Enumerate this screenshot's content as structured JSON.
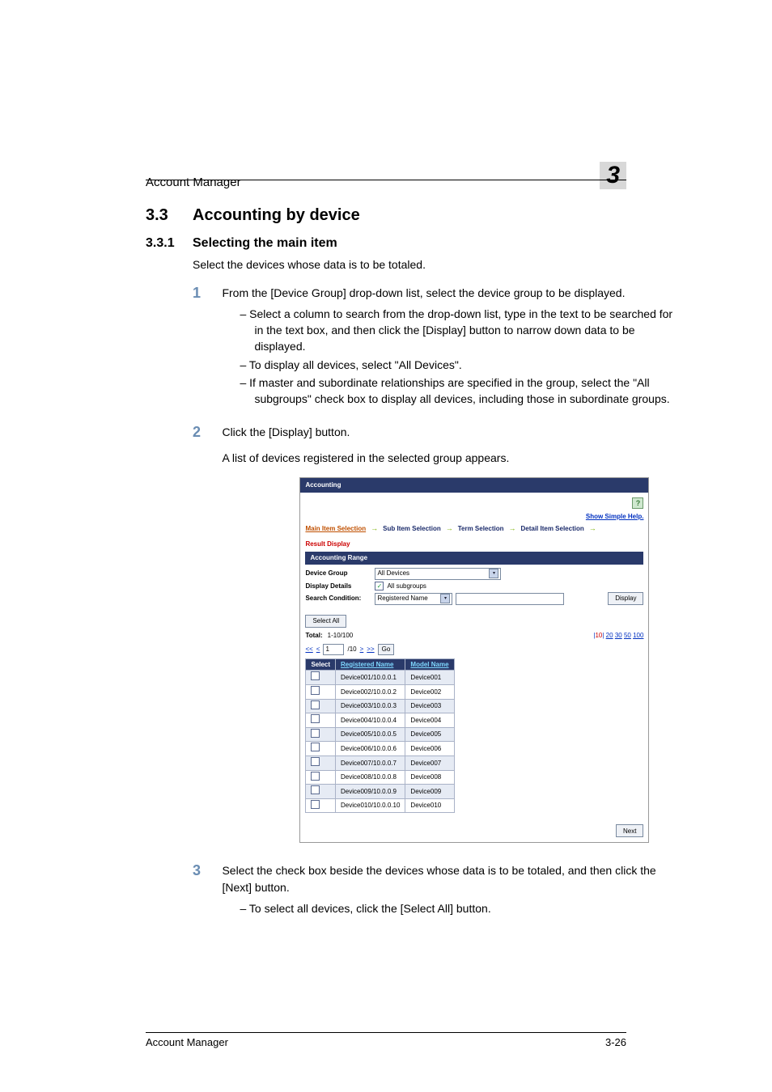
{
  "header": {
    "running": "Account Manager",
    "chapter": "3"
  },
  "section": {
    "h2_num": "3.3",
    "h2_title": "Accounting by device",
    "h3_num": "3.3.1",
    "h3_title": "Selecting the main item",
    "intro": "Select the devices whose data is to be totaled.",
    "steps": {
      "s1": {
        "num": "1",
        "text": "From the [Device Group] drop-down list, select the device group to be displayed.",
        "bullets": [
          "Select a column to search from the drop-down list, type in the text to be searched for in the text box, and then click the [Display] button to narrow down data to be displayed.",
          "To display all devices, select \"All Devices\".",
          "If master and subordinate relationships are specified in the group, select the \"All subgroups\" check box to display all devices, including those in subordinate groups."
        ]
      },
      "s2": {
        "num": "2",
        "text": "Click the [Display] button.",
        "after": "A list of devices registered in the selected group appears."
      },
      "s3": {
        "num": "3",
        "text": "Select the check box beside the devices whose data is to be totaled, and then click the [Next] button.",
        "bullets": [
          "To select all devices, click the [Select All] button."
        ]
      }
    }
  },
  "shot": {
    "title": "Accounting",
    "help_icon": "?",
    "simple_help": "Show Simple Help.",
    "crumbs": {
      "c1": "Main Item Selection",
      "c2": "Sub Item Selection",
      "c3": "Term Selection",
      "c4": "Detail Item Selection",
      "c5": "Result Display"
    },
    "range_hdr": "Accounting Range",
    "device_group_lbl": "Device Group",
    "device_group_val": "All Devices",
    "display_details_lbl": "Display Details",
    "all_subgroups_lbl": "All subgroups",
    "all_subgroups_checked": "✓",
    "search_condition_lbl": "Search Condition:",
    "search_col_val": "Registered Name",
    "display_btn": "Display",
    "select_all_btn": "Select All",
    "total_lbl": "Total:",
    "total_val": "1-10/100",
    "page_sizes": {
      "cur": "10",
      "opts": [
        "20",
        "30",
        "50",
        "100"
      ]
    },
    "pager": {
      "first": "<<",
      "prev": "<",
      "page": "1",
      "of": "/10",
      "next": ">",
      "last": ">>",
      "go": "Go"
    },
    "cols": {
      "select": "Select",
      "reg": "Registered Name",
      "model": "Model Name"
    },
    "rows": [
      {
        "reg": "Device001/10.0.0.1",
        "model": "Device001"
      },
      {
        "reg": "Device002/10.0.0.2",
        "model": "Device002"
      },
      {
        "reg": "Device003/10.0.0.3",
        "model": "Device003"
      },
      {
        "reg": "Device004/10.0.0.4",
        "model": "Device004"
      },
      {
        "reg": "Device005/10.0.0.5",
        "model": "Device005"
      },
      {
        "reg": "Device006/10.0.0.6",
        "model": "Device006"
      },
      {
        "reg": "Device007/10.0.0.7",
        "model": "Device007"
      },
      {
        "reg": "Device008/10.0.0.8",
        "model": "Device008"
      },
      {
        "reg": "Device009/10.0.0.9",
        "model": "Device009"
      },
      {
        "reg": "Device010/10.0.0.10",
        "model": "Device010"
      }
    ],
    "next_btn": "Next"
  },
  "footer": {
    "left": "Account Manager",
    "right": "3-26"
  }
}
